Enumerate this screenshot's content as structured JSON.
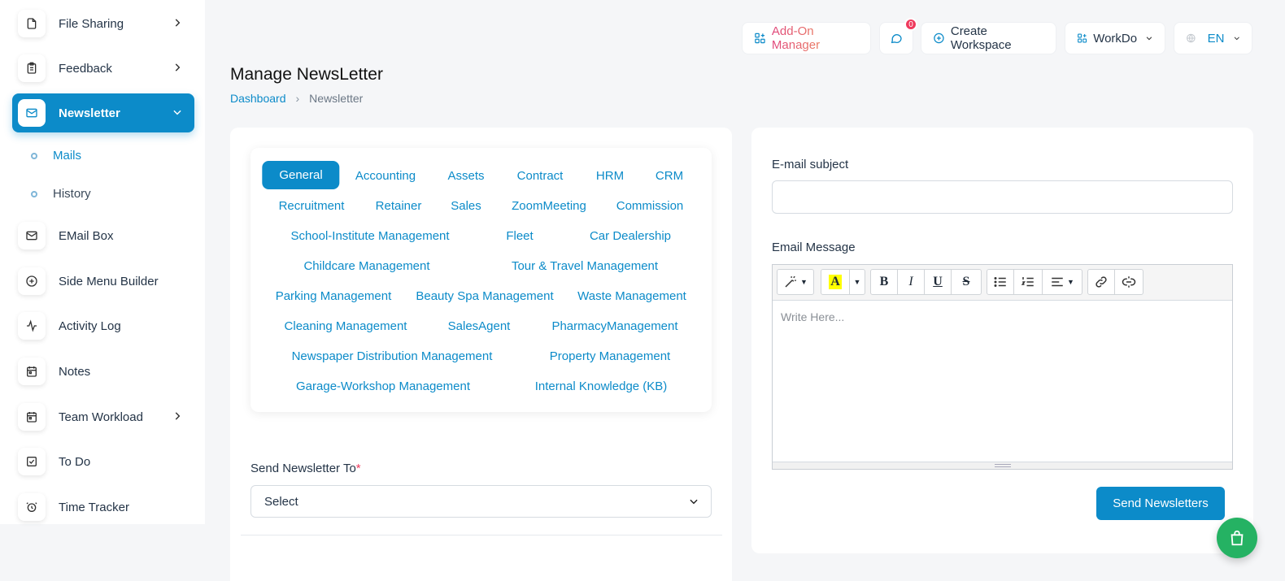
{
  "sidebar": {
    "items": [
      {
        "label": "File Sharing",
        "icon": "file-icon"
      },
      {
        "label": "Feedback",
        "icon": "clipboard-icon"
      },
      {
        "label": "Newsletter",
        "icon": "mail-icon"
      },
      {
        "label": "EMail Box",
        "icon": "mail-icon"
      },
      {
        "label": "Side Menu Builder",
        "icon": "plus-circle-icon"
      },
      {
        "label": "Activity Log",
        "icon": "activity-icon"
      },
      {
        "label": "Notes",
        "icon": "calendar-icon"
      },
      {
        "label": "Team Workload",
        "icon": "calendar-icon"
      },
      {
        "label": "To Do",
        "icon": "check-square-icon"
      },
      {
        "label": "Time Tracker",
        "icon": "alarm-clock-icon"
      }
    ],
    "submenu": [
      {
        "label": "Mails"
      },
      {
        "label": "History"
      }
    ]
  },
  "topbar": {
    "addon_label": "Add-On Manager",
    "chat_badge": "0",
    "create_workspace_label": "Create Workspace",
    "workspace_label": "WorkDo",
    "language_label": "EN"
  },
  "page": {
    "title": "Manage NewsLetter",
    "breadcrumb": {
      "home": "Dashboard",
      "current": "Newsletter"
    }
  },
  "tabs": [
    "General",
    "Accounting",
    "Assets",
    "Contract",
    "HRM",
    "CRM",
    "Recruitment",
    "Retainer",
    "Sales",
    "ZoomMeeting",
    "Commission",
    "School-Institute Management",
    "Fleet",
    "Car Dealership",
    "Childcare Management",
    "Tour & Travel Management",
    "Parking Management",
    "Beauty Spa Management",
    "Waste Management",
    "Cleaning Management",
    "SalesAgent",
    "PharmacyManagement",
    "Newspaper Distribution Management",
    "Property Management",
    "Garage-Workshop Management",
    "Internal Knowledge (KB)"
  ],
  "form": {
    "send_to_label": "Send Newsletter To",
    "required_mark": "*",
    "select_value": "Select",
    "subject_label": "E-mail subject",
    "subject_value": "",
    "message_label": "Email Message",
    "message_placeholder": "Write Here...",
    "send_button": "Send Newsletters"
  },
  "colors": {
    "primary": "#0c8bc9",
    "badge": "#ef3a5d",
    "cart_fab": "#25b263"
  }
}
